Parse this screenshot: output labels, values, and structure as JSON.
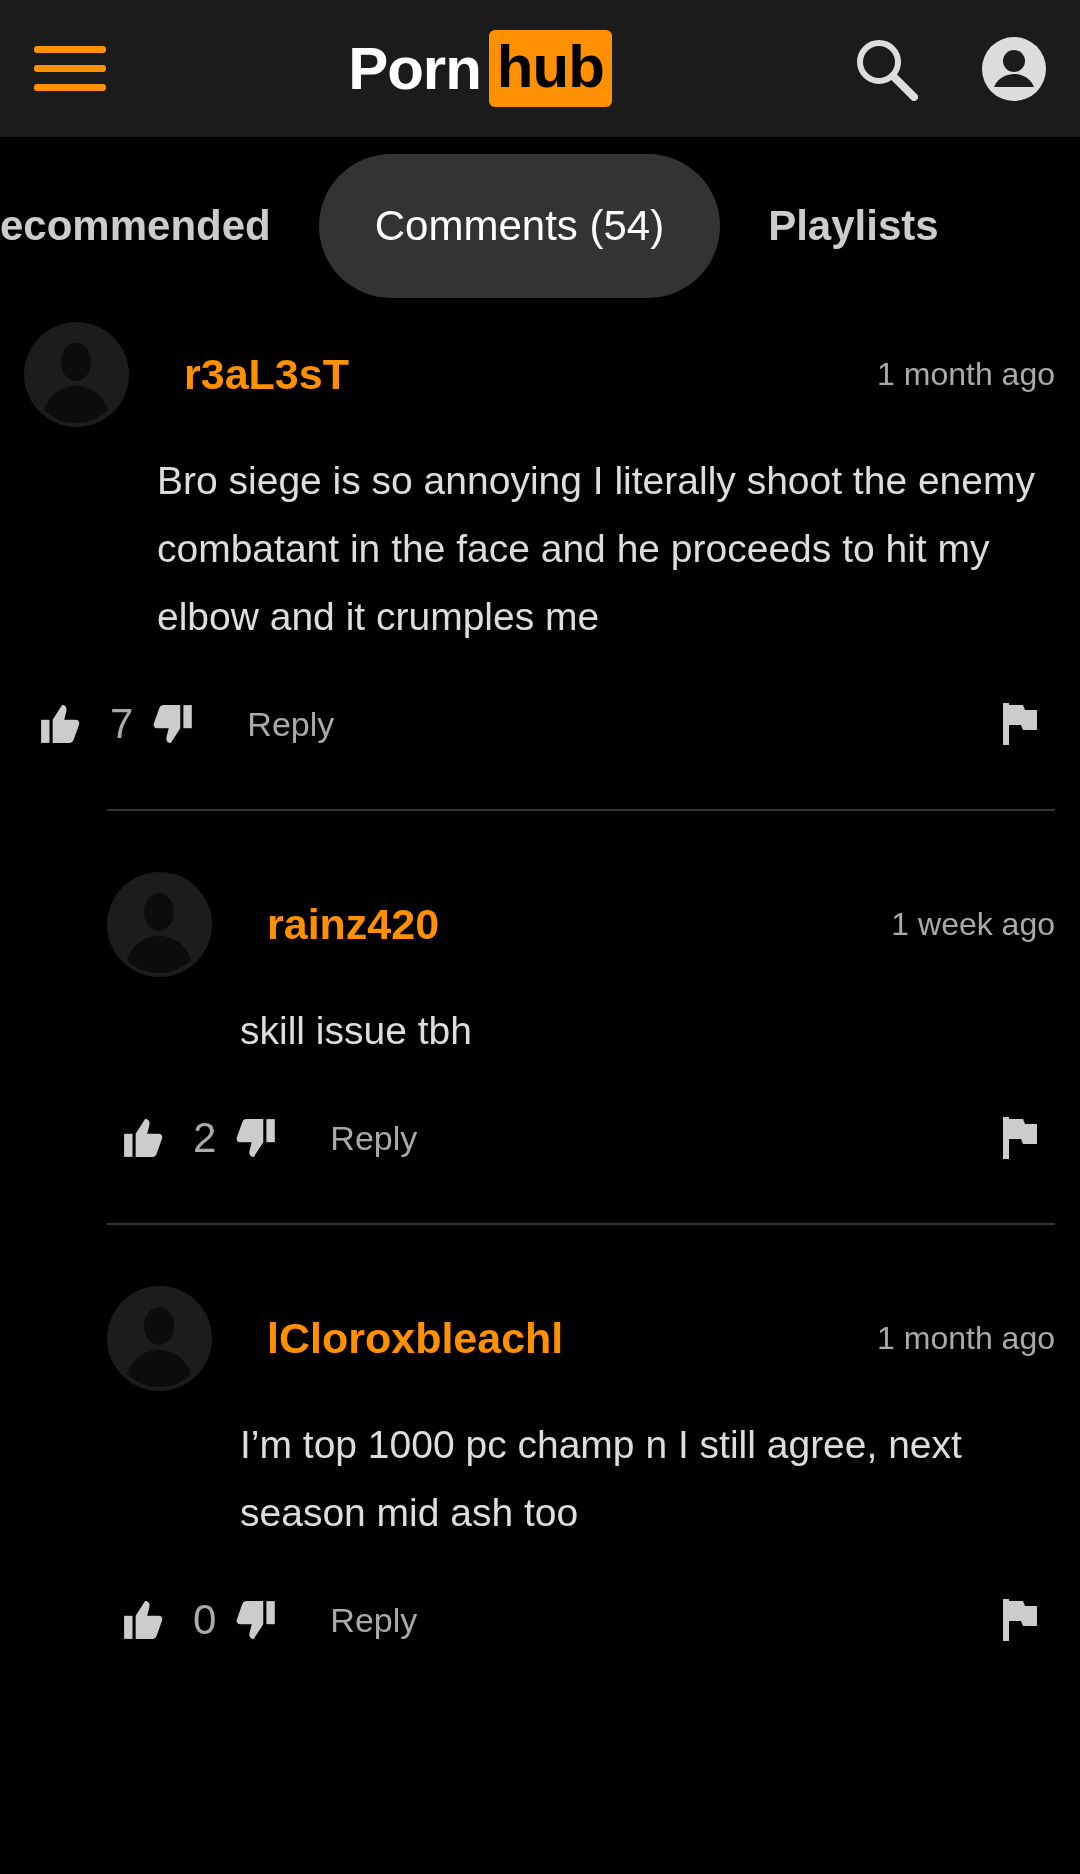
{
  "header": {
    "logo_left": "Porn",
    "logo_right": "hub"
  },
  "tabs": [
    {
      "label": "ecommended",
      "selected": false
    },
    {
      "label": "Comments (54)",
      "selected": true
    },
    {
      "label": "Playlists",
      "selected": false
    }
  ],
  "comments": [
    {
      "username": "r3aL3sT",
      "time": "1 month ago",
      "text": "Bro siege is so annoying I literally shoot the enemy combatant in the face and he proceeds to hit my elbow and it crumples me",
      "likes": "7",
      "reply": "Reply",
      "children": [
        {
          "username": "rainz420",
          "time": "1 week ago",
          "text": "skill issue tbh",
          "likes": "2",
          "reply": "Reply"
        },
        {
          "username": "lCloroxbleachl",
          "time": "1 month ago",
          "text": "I’m top 1000 pc champ n I still agree, next season mid ash too",
          "likes": "0",
          "reply": "Reply"
        }
      ]
    }
  ]
}
